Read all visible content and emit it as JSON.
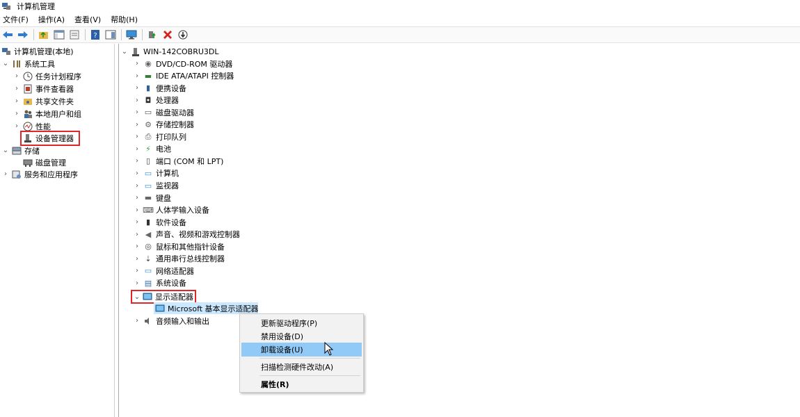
{
  "window": {
    "title": "计算机管理"
  },
  "menu": [
    "文件(F)",
    "操作(A)",
    "查看(V)",
    "帮助(H)"
  ],
  "toolbar": {
    "icons": [
      "back-arrow-icon",
      "forward-arrow-icon",
      "up-folder-icon",
      "show-hide-tree-icon",
      "properties-icon",
      "help-icon",
      "action-pane-icon",
      "monitor-icon",
      "update-driver-icon",
      "uninstall-icon",
      "disable-device-icon"
    ],
    "uninstall_color": "#d9201d"
  },
  "left_tree": {
    "root": "计算机管理(本地)",
    "system_tools": "系统工具",
    "task_scheduler": "任务计划程序",
    "event_viewer": "事件查看器",
    "shared_folders": "共享文件夹",
    "local_users": "本地用户和组",
    "performance": "性能",
    "device_manager": "设备管理器",
    "storage": "存储",
    "disk_management": "磁盘管理",
    "services_apps": "服务和应用程序"
  },
  "device_tree": {
    "computer": "WIN-142COBRU3DL",
    "categories": [
      "DVD/CD-ROM 驱动器",
      "IDE ATA/ATAPI 控制器",
      "便携设备",
      "处理器",
      "磁盘驱动器",
      "存储控制器",
      "打印队列",
      "电池",
      "端口 (COM 和 LPT)",
      "计算机",
      "监视器",
      "键盘",
      "人体学输入设备",
      "软件设备",
      "声音、视频和游戏控制器",
      "鼠标和其他指针设备",
      "通用串行总线控制器",
      "网络适配器",
      "系统设备"
    ],
    "display_adapters": "显示适配器",
    "display_device": "Microsoft 基本显示适配器",
    "audio_io": "音频输入和输出"
  },
  "context_menu": {
    "update_driver": "更新驱动程序(P)",
    "disable_device": "禁用设备(D)",
    "uninstall_device": "卸载设备(U)",
    "scan_hardware": "扫描检测硬件改动(A)",
    "properties": "属性(R)"
  },
  "colors": {
    "highlight_box": "#e0262a",
    "selection": "#cce8ff",
    "menu_hover": "#91c9f7"
  }
}
